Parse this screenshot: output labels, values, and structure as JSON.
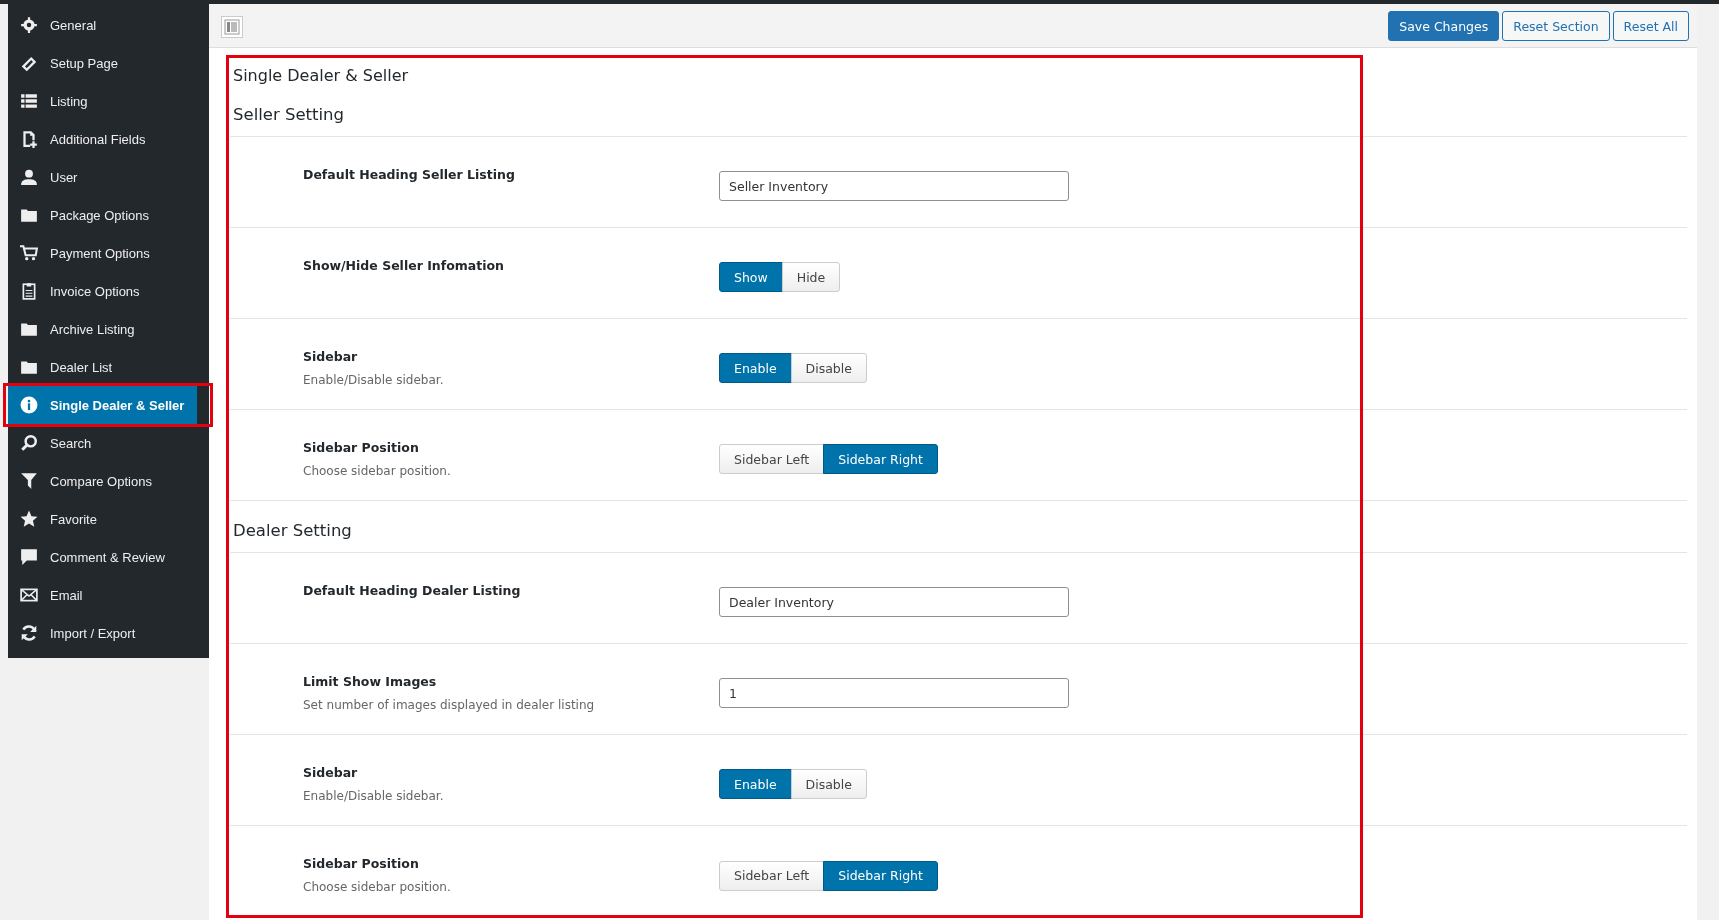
{
  "sidebar": {
    "items": [
      {
        "label": "General",
        "selected": false,
        "highlighted": false
      },
      {
        "label": "Setup Page",
        "selected": false,
        "highlighted": false
      },
      {
        "label": "Listing",
        "selected": false,
        "highlighted": false
      },
      {
        "label": "Additional Fields",
        "selected": false,
        "highlighted": false
      },
      {
        "label": "User",
        "selected": false,
        "highlighted": false
      },
      {
        "label": "Package Options",
        "selected": false,
        "highlighted": false
      },
      {
        "label": "Payment Options",
        "selected": false,
        "highlighted": false
      },
      {
        "label": "Invoice Options",
        "selected": false,
        "highlighted": false
      },
      {
        "label": "Archive Listing",
        "selected": false,
        "highlighted": false
      },
      {
        "label": "Dealer List",
        "selected": false,
        "highlighted": false
      },
      {
        "label": "Single Dealer & Seller",
        "selected": true,
        "highlighted": true
      },
      {
        "label": "Search",
        "selected": false,
        "highlighted": false
      },
      {
        "label": "Compare Options",
        "selected": false,
        "highlighted": false
      },
      {
        "label": "Favorite",
        "selected": false,
        "highlighted": false
      },
      {
        "label": "Comment & Review",
        "selected": false,
        "highlighted": false
      },
      {
        "label": "Email",
        "selected": false,
        "highlighted": false
      },
      {
        "label": "Import / Export",
        "selected": false,
        "highlighted": false
      }
    ]
  },
  "toolbar": {
    "buttons": [
      {
        "label": "Save Changes",
        "kind": "primary"
      },
      {
        "label": "Reset Section",
        "kind": "secondary"
      },
      {
        "label": "Reset All",
        "kind": "secondary"
      }
    ]
  },
  "content": {
    "title": "Single Dealer & Seller",
    "highlighted": true,
    "sections": [
      {
        "heading": "Seller Setting",
        "fields": [
          {
            "kind": "text",
            "label": "Default Heading Seller Listing",
            "value": "Seller Inventory"
          },
          {
            "kind": "toggle",
            "label": "Show/Hide Seller Infomation",
            "options": [
              {
                "label": "Show",
                "selected": true
              },
              {
                "label": "Hide",
                "selected": false
              }
            ]
          },
          {
            "kind": "toggle",
            "label": "Sidebar",
            "description": "Enable/Disable sidebar.",
            "options": [
              {
                "label": "Enable",
                "selected": true
              },
              {
                "label": "Disable",
                "selected": false
              }
            ]
          },
          {
            "kind": "toggle",
            "label": "Sidebar Position",
            "description": "Choose sidebar position.",
            "options": [
              {
                "label": "Sidebar Left",
                "selected": false
              },
              {
                "label": "Sidebar Right",
                "selected": true
              }
            ]
          }
        ]
      },
      {
        "heading": "Dealer Setting",
        "fields": [
          {
            "kind": "text",
            "label": "Default Heading Dealer Listing",
            "value": "Dealer Inventory"
          },
          {
            "kind": "text",
            "label": "Limit Show Images",
            "description": "Set number of images displayed in dealer listing",
            "value": "1"
          },
          {
            "kind": "toggle",
            "label": "Sidebar",
            "description": "Enable/Disable sidebar.",
            "options": [
              {
                "label": "Enable",
                "selected": true
              },
              {
                "label": "Disable",
                "selected": false
              }
            ]
          },
          {
            "kind": "toggle",
            "label": "Sidebar Position",
            "description": "Choose sidebar position.",
            "options": [
              {
                "label": "Sidebar Left",
                "selected": false
              },
              {
                "label": "Sidebar Right",
                "selected": true
              }
            ]
          }
        ]
      }
    ]
  }
}
